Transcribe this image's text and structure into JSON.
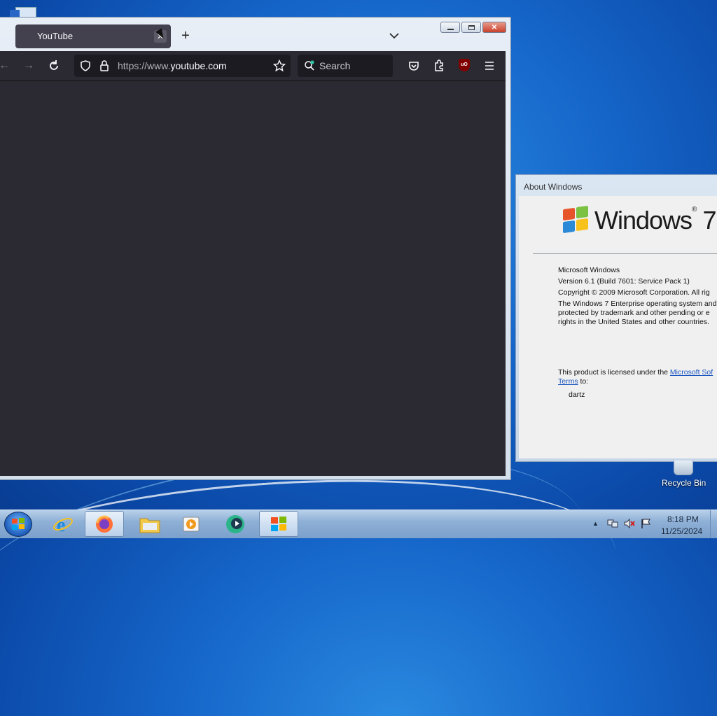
{
  "browser": {
    "tab_title": "YouTube",
    "url_prefix": "https://www.",
    "url_domain": "youtube.com",
    "search_placeholder": "Search",
    "ublock_label": "uO"
  },
  "about_dialog": {
    "title": "About Windows",
    "logo_text": "Windows",
    "logo_version": "7",
    "lines": [
      "Microsoft Windows",
      "Version 6.1 (Build 7601: Service Pack 1)",
      "Copyright © 2009 Microsoft Corporation.  All rig",
      "The Windows 7 Enterprise operating system and",
      "protected by trademark and other pending or e",
      "rights in the United States and other countries."
    ],
    "license_prefix": "This product is licensed under the ",
    "license_link": "Microsoft Sof",
    "license_link2": "Terms",
    "license_suffix": " to:",
    "licensee": "dartz"
  },
  "desktop": {
    "recycle_bin_label": "Recycle Bin"
  },
  "taskbar": {
    "clock_time": "8:18 PM",
    "clock_date": "11/25/2024",
    "pinned": [
      "start",
      "internet-explorer",
      "firefox",
      "file-explorer",
      "media-player",
      "app-green",
      "windows-active"
    ]
  }
}
